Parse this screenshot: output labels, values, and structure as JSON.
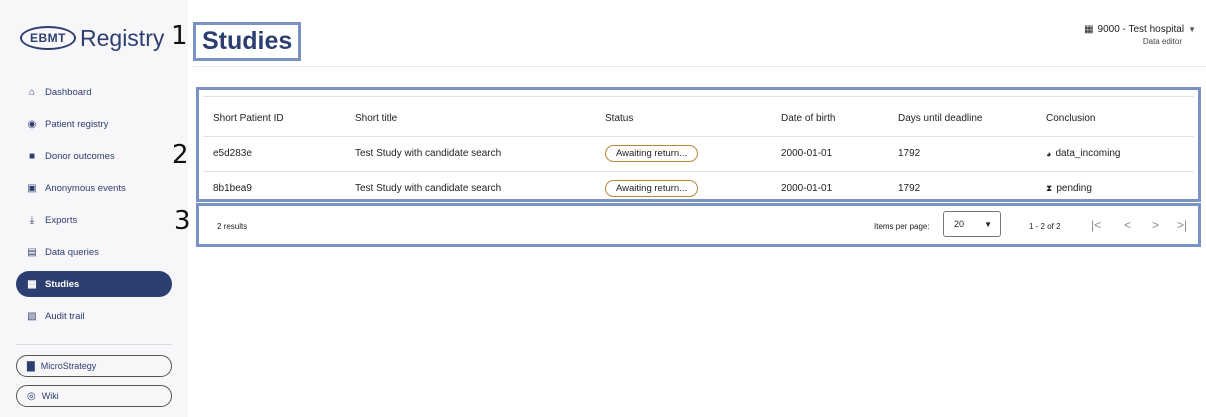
{
  "logo": {
    "badge": "EBMT",
    "text": "Registry"
  },
  "annotations": [
    "1",
    "2",
    "3"
  ],
  "sidebar": {
    "items": [
      {
        "label": "Dashboard",
        "icon": "home-icon",
        "glyph": "⌂"
      },
      {
        "label": "Patient registry",
        "icon": "person-icon",
        "glyph": "◉"
      },
      {
        "label": "Donor outcomes",
        "icon": "folder-icon",
        "glyph": "■"
      },
      {
        "label": "Anonymous events",
        "icon": "briefcase-icon",
        "glyph": "▣"
      },
      {
        "label": "Exports",
        "icon": "download-icon",
        "glyph": "⤓"
      },
      {
        "label": "Data queries",
        "icon": "comment-icon",
        "glyph": "▤"
      },
      {
        "label": "Studies",
        "icon": "archive-icon",
        "glyph": "▦",
        "active": true
      },
      {
        "label": "Audit trail",
        "icon": "audit-icon",
        "glyph": "▧"
      }
    ],
    "external": [
      {
        "label": "MicroStrategy",
        "icon": "bar-chart-icon",
        "glyph": "▇"
      },
      {
        "label": "Wiki",
        "icon": "globe-icon",
        "glyph": "◎"
      }
    ]
  },
  "header": {
    "title": "Studies",
    "hospital": "9000 - Test hospital",
    "role": "Data editor"
  },
  "table": {
    "columns": [
      "Short Patient ID",
      "Short title",
      "Status",
      "Date of birth",
      "Days until deadline",
      "Conclusion"
    ],
    "rows": [
      {
        "id": "e5d283e",
        "title": "Test Study with candidate search",
        "status": "Awaiting return...",
        "dob": "2000-01-01",
        "days": "1792",
        "conclusion": "data_incoming",
        "conclusion_glyph": "◕"
      },
      {
        "id": "8b1bea9",
        "title": "Test Study with candidate search",
        "status": "Awaiting return...",
        "dob": "2000-01-01",
        "days": "1792",
        "conclusion": "pending",
        "conclusion_glyph": "⧗"
      }
    ]
  },
  "pagination": {
    "results": "2 results",
    "items_per_page_label": "Items per page:",
    "items_per_page": "20",
    "range": "1 - 2 of 2"
  },
  "colors": {
    "primary": "#2d3e70",
    "annotation_border": "#7b93c4",
    "status_border": "#b8873a"
  }
}
